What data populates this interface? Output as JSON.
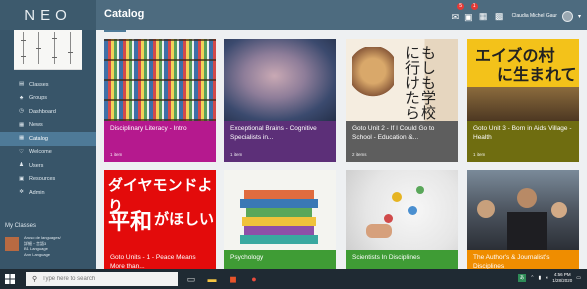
{
  "app": {
    "brand": "NEO",
    "page_title": "Catalog"
  },
  "topbar": {
    "icons": [
      "chat-icon",
      "calendar-icon",
      "grid-icon",
      "bell-icon"
    ],
    "badges": [
      "5",
      "1"
    ],
    "username": "Claudia Michel Gaur",
    "caret": "▾"
  },
  "sidebar": {
    "items": [
      {
        "label": "Classes",
        "icon": "▤"
      },
      {
        "label": "Groups",
        "icon": "♣"
      },
      {
        "label": "Dashboard",
        "icon": "◷"
      },
      {
        "label": "News",
        "icon": "▦"
      },
      {
        "label": "Catalog",
        "icon": "▦",
        "active": true
      },
      {
        "label": "Welcome",
        "icon": "♡"
      },
      {
        "label": "Users",
        "icon": "♟"
      },
      {
        "label": "Resources",
        "icon": "▣"
      },
      {
        "label": "Admin",
        "icon": "✲"
      }
    ],
    "my_classes_title": "My Classes",
    "classes": [
      {
        "lines": [
          "Aruso de languages/",
          "詳細・言語3",
          "B1 Language",
          "Ann Language"
        ]
      }
    ]
  },
  "catalog": {
    "cards": [
      {
        "title": "Disciplinary Literacy - Intro",
        "items": "1 item",
        "color": "#b5198e"
      },
      {
        "title": "Exceptional Brains - Cognitive Specialists in...",
        "items": "1 item",
        "color": "#5c2f78"
      },
      {
        "title": "Goto Unit 2 - If I Could Go to School - Education &...",
        "items": "2 items",
        "color": "#5e5e5e"
      },
      {
        "title": "Goto Unit 3 - Born in Aids Village - Health",
        "items": "1 item",
        "color": "#6f6d10"
      },
      {
        "title": "Goto Units - 1 - Peace Means More than...",
        "items": "",
        "color": "#e30b0b"
      },
      {
        "title": "Psychology",
        "items": "",
        "color": "#3f9c35"
      },
      {
        "title": "Scientists In Disciplines",
        "items": "",
        "color": "#3f9c35"
      },
      {
        "title": "The Author's & Journalist's Disciplines",
        "items": "",
        "color": "#ef8d00"
      }
    ]
  },
  "taskbar": {
    "search_placeholder": "Type here to search",
    "time": "4:56 PM",
    "date": "1/28/2020"
  }
}
